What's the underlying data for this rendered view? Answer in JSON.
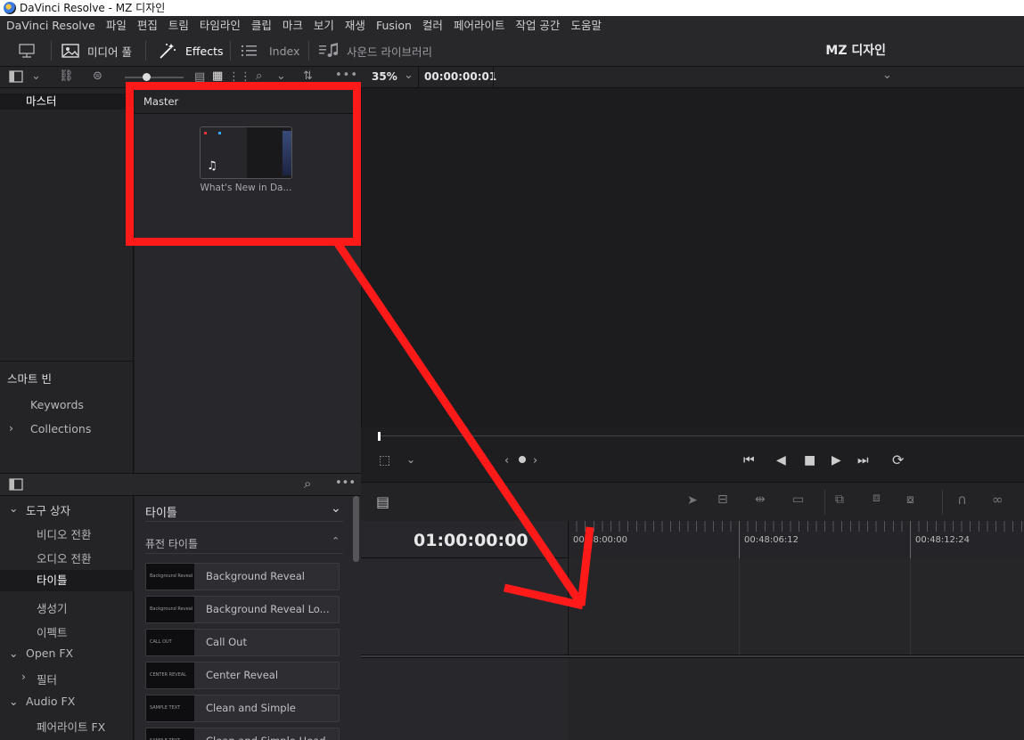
{
  "window": {
    "title": "DaVinci Resolve - MZ 디자인"
  },
  "menu": [
    "DaVinci Resolve",
    "파일",
    "편집",
    "트림",
    "타임라인",
    "클립",
    "마크",
    "보기",
    "재생",
    "Fusion",
    "컬러",
    "페어라이트",
    "작업 공간",
    "도움말"
  ],
  "toolbar": {
    "media_pool": "미디어 풀",
    "effects": "Effects",
    "index": "Index",
    "sound_library": "사운드 라이브러리",
    "project_name": "MZ 디자인"
  },
  "viewer": {
    "zoom": "35%",
    "timecode": "00:00:00:01"
  },
  "bins": {
    "master": "마스터",
    "smart_bins_header": "스마트 빈",
    "keywords": "Keywords",
    "collections": "Collections"
  },
  "media_pool": {
    "header": "Master",
    "clip_name": "What's New in Da..."
  },
  "toolbox": {
    "header": "도구 상자",
    "video_transition": "비디오 전환",
    "audio_transition": "오디오 전환",
    "titles": "타이틀",
    "generators": "생성기",
    "effects": "이펙트",
    "open_fx": "Open FX",
    "filters": "필터",
    "audio_fx": "Audio FX",
    "fairlight_fx": "페어라이트 FX"
  },
  "effects_list": {
    "dropdown": "타이틀",
    "section": "퓨전 타이틀",
    "items": [
      {
        "label": "Background Reveal",
        "thumb": "Background Reveal"
      },
      {
        "label": "Background Reveal Lo...",
        "thumb": "Background Reveal"
      },
      {
        "label": "Call Out",
        "thumb": "CALL OUT"
      },
      {
        "label": "Center Reveal",
        "thumb": "CENTER REVEAL"
      },
      {
        "label": "Clean and Simple",
        "thumb": "SAMPLE TEXT"
      },
      {
        "label": "Clean and Simple Head...",
        "thumb": "SAMPLE TEXT"
      }
    ]
  },
  "timeline": {
    "current_tc": "01:00:00:00",
    "ruler_labels": [
      "00:48:00:00",
      "00:48:06:12",
      "00:48:12:24"
    ]
  },
  "colors": {
    "annotation_red": "#ff1a1a",
    "panel": "#28282c",
    "background": "#1c1c1e"
  }
}
